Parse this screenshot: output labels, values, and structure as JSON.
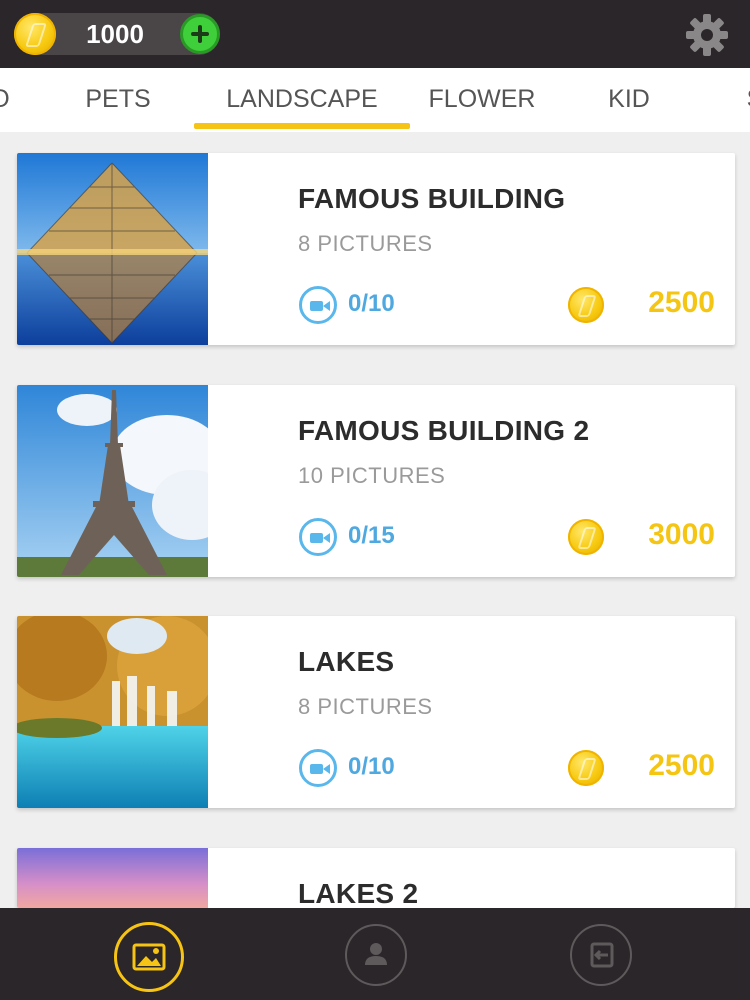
{
  "header": {
    "coins": "1000",
    "icons": {
      "coin": "coin-icon",
      "add": "plus-icon",
      "settings": "gear-icon"
    }
  },
  "tabs": [
    {
      "label": "O"
    },
    {
      "label": "PETS"
    },
    {
      "label": "LANDSCAPE",
      "selected": true
    },
    {
      "label": "FLOWER"
    },
    {
      "label": "KID"
    },
    {
      "label": "S"
    }
  ],
  "packs": [
    {
      "title": "FAMOUS BUILDING",
      "subtitle": "8 PICTURES",
      "videos": "0/10",
      "price": "2500"
    },
    {
      "title": "FAMOUS BUILDING 2",
      "subtitle": "10 PICTURES",
      "videos": "0/15",
      "price": "3000"
    },
    {
      "title": "LAKES",
      "subtitle": "8 PICTURES",
      "videos": "0/10",
      "price": "2500"
    },
    {
      "title": "LAKES 2"
    }
  ],
  "bottom_nav": [
    {
      "icon": "gallery-icon",
      "active": true
    },
    {
      "icon": "profile-icon"
    },
    {
      "icon": "share-icon"
    }
  ],
  "colors": {
    "accent": "#f6c414",
    "bar": "#2b2629",
    "video": "#5ab7ec",
    "add": "#3fcf3a"
  }
}
